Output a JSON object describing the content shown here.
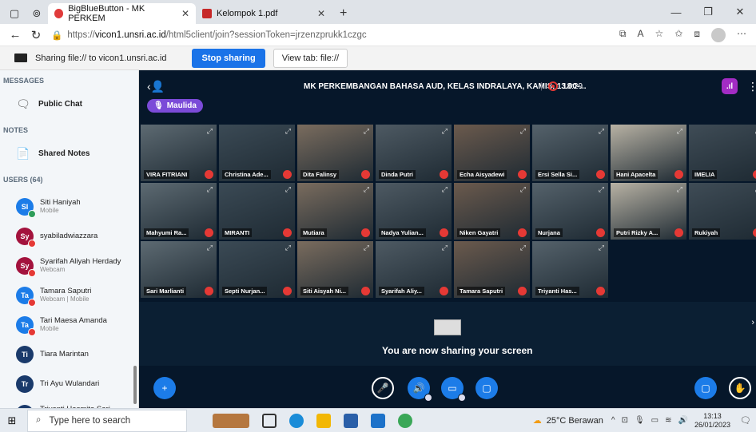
{
  "browser": {
    "tabs": [
      {
        "title": "BigBlueButton - MK PERKEM",
        "active": true
      },
      {
        "title": "Kelompok 1.pdf",
        "active": false
      }
    ],
    "url_prefix": "https://",
    "url_host": "vicon1.unsri.ac.id",
    "url_path": "/html5client/join?sessionToken=jrzenzprukk1czgc"
  },
  "sharing_bar": {
    "text": "Sharing file:// to vicon1.unsri.ac.id",
    "stop_label": "Stop sharing",
    "view_label": "View tab: file://"
  },
  "sidebar": {
    "messages_title": "MESSAGES",
    "public_chat": "Public Chat",
    "notes_title": "NOTES",
    "shared_notes": "Shared Notes",
    "users_title": "USERS (64)",
    "users": [
      {
        "initials": "SI",
        "name": "Siti Haniyah",
        "sub": "Mobile",
        "color": "#1c7ce8",
        "status": "#2e9d5a"
      },
      {
        "initials": "Sy",
        "name": "syabiladwiazzara",
        "sub": "",
        "color": "#a3123d",
        "status": "#e53935"
      },
      {
        "initials": "Sy",
        "name": "Syarifah Aliyah Herdady",
        "sub": "Webcam",
        "color": "#a3123d",
        "status": "#e53935"
      },
      {
        "initials": "Ta",
        "name": "Tamara Saputri",
        "sub": "Webcam | Mobile",
        "color": "#1c7ce8",
        "status": "#e53935"
      },
      {
        "initials": "Ta",
        "name": "Tari Maesa Amanda",
        "sub": "Mobile",
        "color": "#1c7ce8",
        "status": "#e53935"
      },
      {
        "initials": "Ti",
        "name": "Tiara Marintan",
        "sub": "",
        "color": "#1a3a6b",
        "status": ""
      },
      {
        "initials": "Tr",
        "name": "Tri Ayu Wulandari",
        "sub": "",
        "color": "#1a3a6b",
        "status": ""
      },
      {
        "initials": "Tr",
        "name": "Triyanti Hasmita Sari",
        "sub": "Webcam | Mobile",
        "color": "#1a3a6b",
        "status": "#e53935"
      }
    ]
  },
  "meeting": {
    "title": "MK PERKEMBANGAN BAHASA AUD, KELAS INDRALAYA, KAMIS, 13.00-...",
    "recording_time": "18:29",
    "presenter_pill": "Maulida",
    "share_message": "You are now sharing your screen",
    "participants": [
      "VIRA FITRIANI",
      "Christina Ade...",
      "Dita Falinsy",
      "Dinda Putri",
      "Echa Aisyadewi",
      "Ersi Sella Si...",
      "Hani Apacelta",
      "IMELIA",
      "Mahyumi Ra...",
      "MIRANTI",
      "Mutiara",
      "Nadya Yulian...",
      "Niken Gayatri",
      "Nurjana",
      "Putri Rizky A...",
      "Rukiyah",
      "Sari Marlianti",
      "Septi Nurjan...",
      "Siti Aisyah Ni...",
      "Syarifah Aliy...",
      "Tamara Saputri",
      "Triyanti Has..."
    ]
  },
  "taskbar": {
    "search_placeholder": "Type here to search",
    "weather": "25°C  Berawan",
    "time": "13:13",
    "date": "26/01/2023"
  }
}
